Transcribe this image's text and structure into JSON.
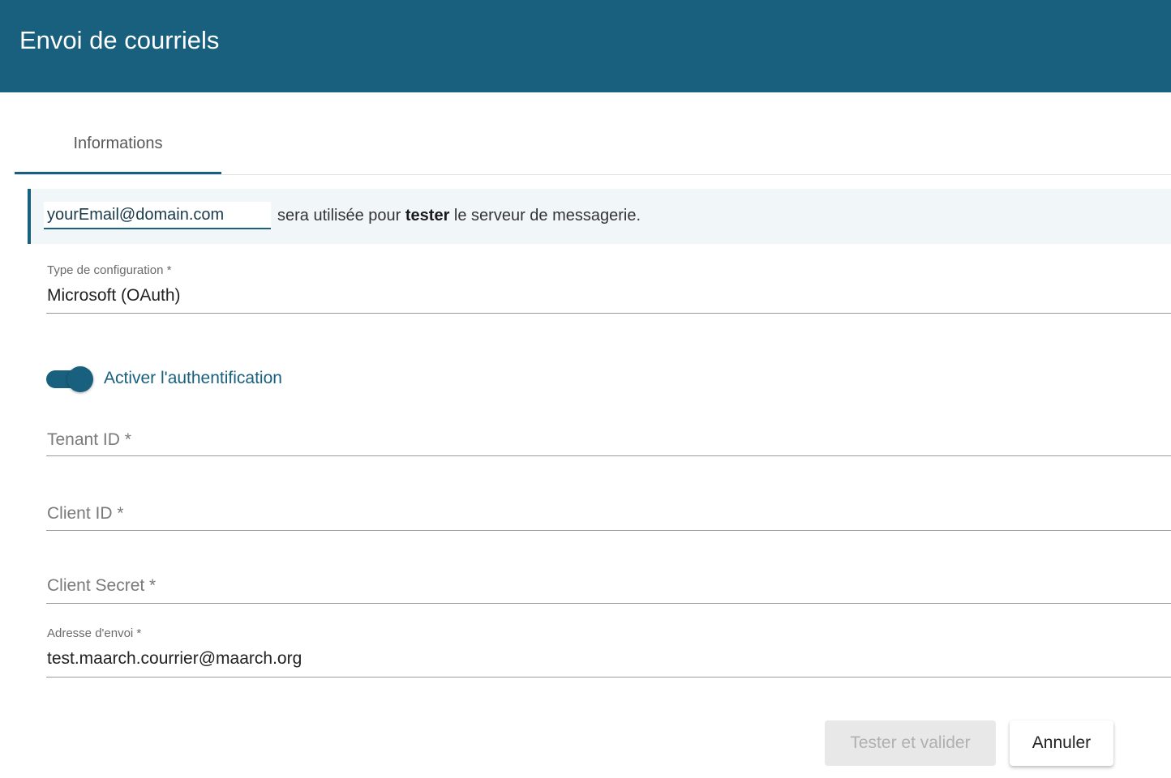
{
  "header": {
    "title": "Envoi de courriels"
  },
  "tabs": [
    {
      "label": "Informations",
      "active": true
    }
  ],
  "test_banner": {
    "email_value": "yourEmail@domain.com",
    "text_before": "sera utilisée pour ",
    "text_bold": "tester",
    "text_after": " le serveur de messagerie."
  },
  "form": {
    "config_type": {
      "label": "Type de configuration *",
      "value": "Microsoft (OAuth)"
    },
    "auth_toggle": {
      "label": "Activer l'authentification",
      "checked": true
    },
    "tenant_id": {
      "placeholder": "Tenant ID *",
      "value": ""
    },
    "client_id": {
      "placeholder": "Client ID *",
      "value": ""
    },
    "client_secret": {
      "placeholder": "Client Secret *",
      "value": ""
    },
    "sender_address": {
      "label": "Adresse d'envoi *",
      "value": "test.maarch.courrier@maarch.org"
    }
  },
  "actions": {
    "test_label": "Tester et valider",
    "cancel_label": "Annuler"
  },
  "colors": {
    "primary": "#18607d",
    "banner_bg": "#f1f6f9",
    "disabled_bg": "#e8e8e8",
    "disabled_text": "#b0b0b0"
  }
}
